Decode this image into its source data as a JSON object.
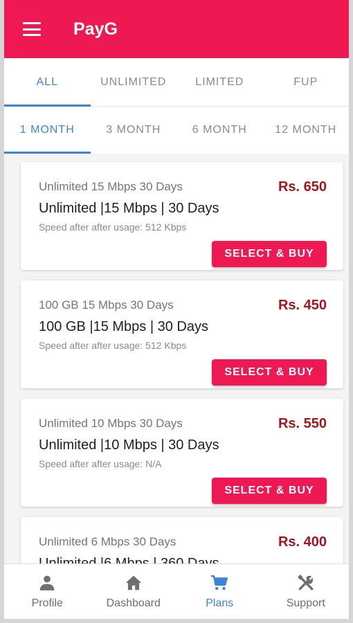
{
  "app": {
    "title": "PayG"
  },
  "type_tabs": [
    {
      "label": "ALL",
      "active": true
    },
    {
      "label": "UNLIMITED",
      "active": false
    },
    {
      "label": "LIMITED",
      "active": false
    },
    {
      "label": "FUP",
      "active": false
    }
  ],
  "duration_tabs": [
    {
      "label": "1 MONTH",
      "active": true
    },
    {
      "label": "3 MONTH",
      "active": false
    },
    {
      "label": "6 MONTH",
      "active": false
    },
    {
      "label": "12 MONTH",
      "active": false
    }
  ],
  "plans": [
    {
      "name": "Unlimited 15 Mbps 30 Days",
      "price": "Rs. 650",
      "detail": "Unlimited |15 Mbps | 30 Days",
      "speed_note": "Speed after after usage: 512 Kbps",
      "button": "SELECT & BUY"
    },
    {
      "name": "100 GB 15 Mbps 30 Days",
      "price": "Rs. 450",
      "detail": "100 GB |15 Mbps | 30 Days",
      "speed_note": "Speed after after usage: 512 Kbps",
      "button": "SELECT & BUY"
    },
    {
      "name": "Unlimited 10 Mbps 30 Days",
      "price": "Rs. 550",
      "detail": "Unlimited |10 Mbps | 30 Days",
      "speed_note": "Speed after after usage: N/A",
      "button": "SELECT & BUY"
    },
    {
      "name": "Unlimited 6 Mbps 30 Days",
      "price": "Rs. 400",
      "detail": "Unlimited |6 Mbps | 360 Days",
      "speed_note": "",
      "button": ""
    }
  ],
  "bottom_nav": [
    {
      "label": "Profile",
      "icon": "person-icon",
      "active": false
    },
    {
      "label": "Dashboard",
      "icon": "home-icon",
      "active": false
    },
    {
      "label": "Plans",
      "icon": "cart-icon",
      "active": true
    },
    {
      "label": "Support",
      "icon": "tools-icon",
      "active": false
    }
  ],
  "colors": {
    "primary": "#ee1852",
    "accent": "#3e84d6",
    "price": "#a5161e"
  }
}
